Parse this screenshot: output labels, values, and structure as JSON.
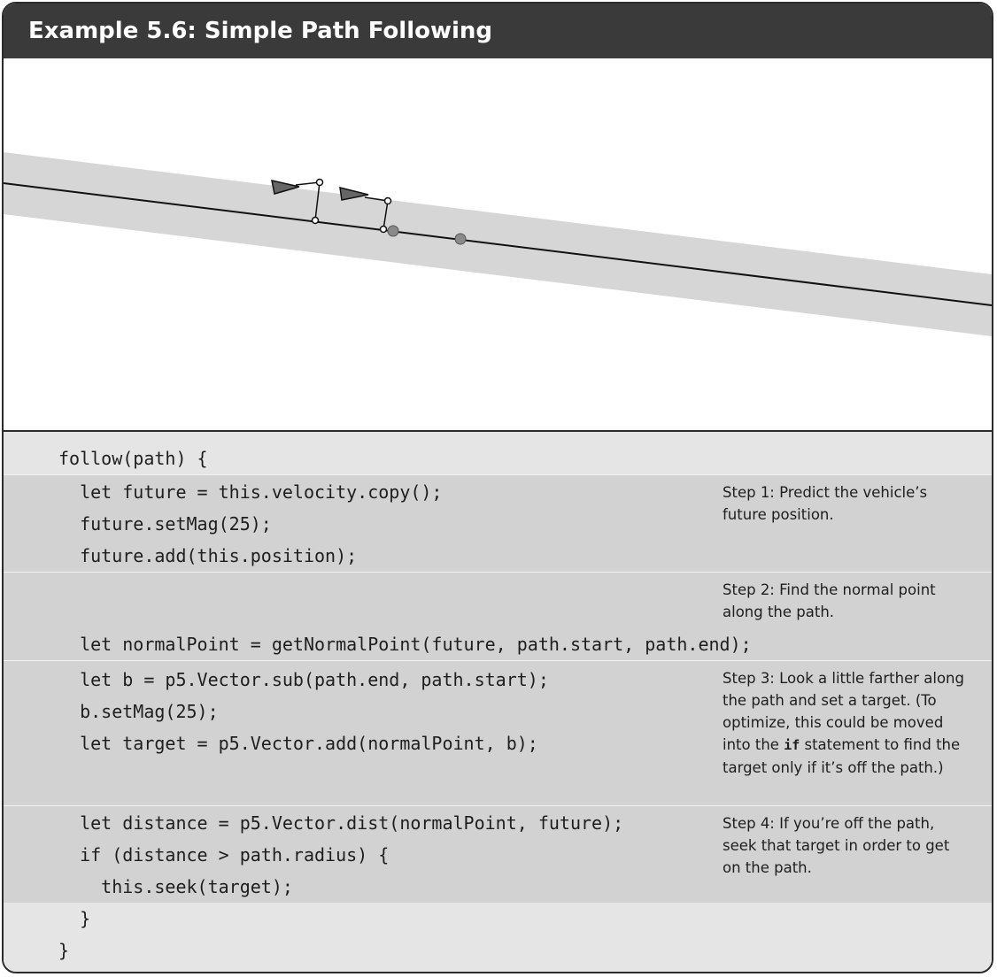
{
  "title": "Example 5.6: Simple Path Following",
  "code": {
    "line_01": "follow(path) {",
    "line_02": "  let future = this.velocity.copy();",
    "line_03": "  future.setMag(25);",
    "line_04": "  future.add(this.position);",
    "line_05": "  let normalPoint = getNormalPoint(future, path.start, path.end);",
    "line_06": "  let b = p5.Vector.sub(path.end, path.start);",
    "line_07": "  b.setMag(25);",
    "line_08": "  let target = p5.Vector.add(normalPoint, b);",
    "line_09": "  let distance = p5.Vector.dist(normalPoint, future);",
    "line_10": "  if (distance > path.radius) {",
    "line_11": "    this.seek(target);",
    "line_12": "  }",
    "line_13": "}"
  },
  "notes": {
    "step1": "Step 1: Predict the vehicle’s future position.",
    "step2": "Step 2: Find the normal point along the path.",
    "step3_before": "Step 3: Look a little farther along the path and set a target. (To optimize, this could be moved into the ",
    "step3_code": "if",
    "step3_after": " statement to find the target only if it’s off the path.)",
    "step4": "Step 4: If you’re off the path, seek that target in order to get on the path."
  },
  "colors": {
    "header_bg": "#3a3a3a",
    "path_band": "#d6d6d6",
    "code_bg": "#e5e5e5",
    "code_band": "#d2d2d2"
  }
}
